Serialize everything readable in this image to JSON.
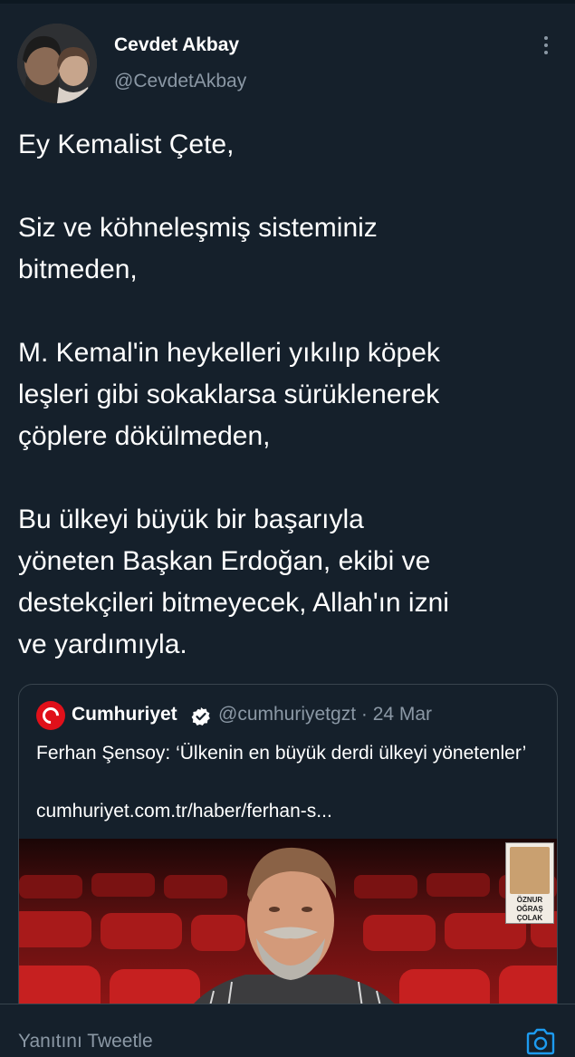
{
  "tweet": {
    "author_name": "Cevdet Akbay",
    "author_handle": "@CevdetAkbay",
    "text": "Ey Kemalist Çete,\n\nSiz ve köhneleşmiş sisteminiz\nbitmeden,\n\nM. Kemal'in heykelleri yıkılıp köpek\nleşleri gibi sokaklarsa sürüklenerek\nçöplere dökülmeden,\n\nBu ülkeyi büyük bir başarıyla\nyöneten Başkan Erdoğan, ekibi ve\ndestekçileri bitmeyecek, Allah'ın izni\nve yardımıyla."
  },
  "quoted": {
    "name": "Cumhuriyet",
    "handle_date": "@cumhuriyetgzt · 24 Mar",
    "title": "Ferhan Şensoy: ‘Ülkenin en büyük derdi ülkeyi yönetenler’",
    "link": "cumhuriyet.com.tr/haber/ferhan-s...",
    "stamp_text": "ÖZNUR OĞRAŞ ÇOLAK"
  },
  "reply": {
    "placeholder": "Yanıtını Tweetle"
  },
  "icons": {
    "more": "more-vertical-icon",
    "verified": "verified-badge-icon",
    "camera": "camera-icon"
  },
  "colors": {
    "background": "#15202b",
    "secondary_text": "#8b98a5",
    "accent": "#1d9bf0",
    "brand_red": "#e0101a"
  }
}
